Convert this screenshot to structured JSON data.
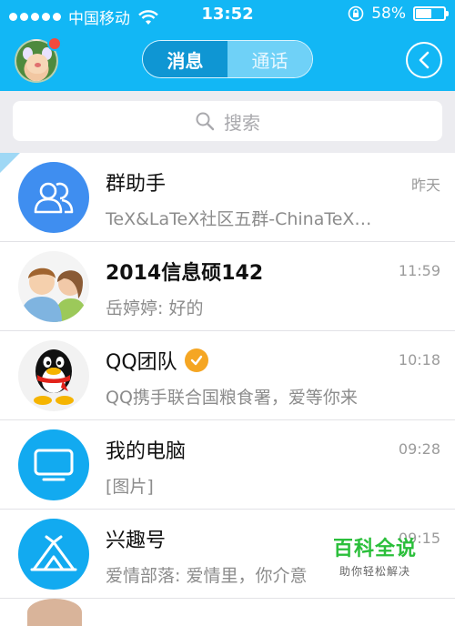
{
  "status": {
    "carrier": "中国移动",
    "time": "13:52",
    "battery_pct": "58%",
    "battery_level": 0.58
  },
  "header": {
    "tab_messages": "消息",
    "tab_calls": "通话",
    "back_icon": "chevron-left-icon",
    "has_notification": true
  },
  "search": {
    "placeholder": "搜索",
    "icon": "search-icon"
  },
  "conversations": [
    {
      "title": "群助手",
      "time": "昨天",
      "preview": "TeX&LaTeX社区五群-ChinaTeX…",
      "icon": "group-assistant-icon"
    },
    {
      "title": "2014信息硕142",
      "time": "11:59",
      "preview": "岳婷婷: 好的",
      "icon": "group-avatar"
    },
    {
      "title": "QQ团队",
      "time": "10:18",
      "preview": "QQ携手联合国粮食署，爱等你来",
      "icon": "penguin-icon",
      "verified": true
    },
    {
      "title": "我的电脑",
      "time": "09:28",
      "preview": "[图片]",
      "icon": "monitor-icon"
    },
    {
      "title": "兴趣号",
      "time": "09:15",
      "preview": "爱情部落: 爱情里，你介意",
      "icon": "tent-icon"
    }
  ],
  "watermark": {
    "main": "百科全说",
    "sub": "助你轻松解决"
  },
  "colors": {
    "brand_blue": "#12b7f5",
    "segment_active": "#0f96d3",
    "verified_orange": "#f5a623",
    "watermark_green": "#2bbf3b"
  }
}
